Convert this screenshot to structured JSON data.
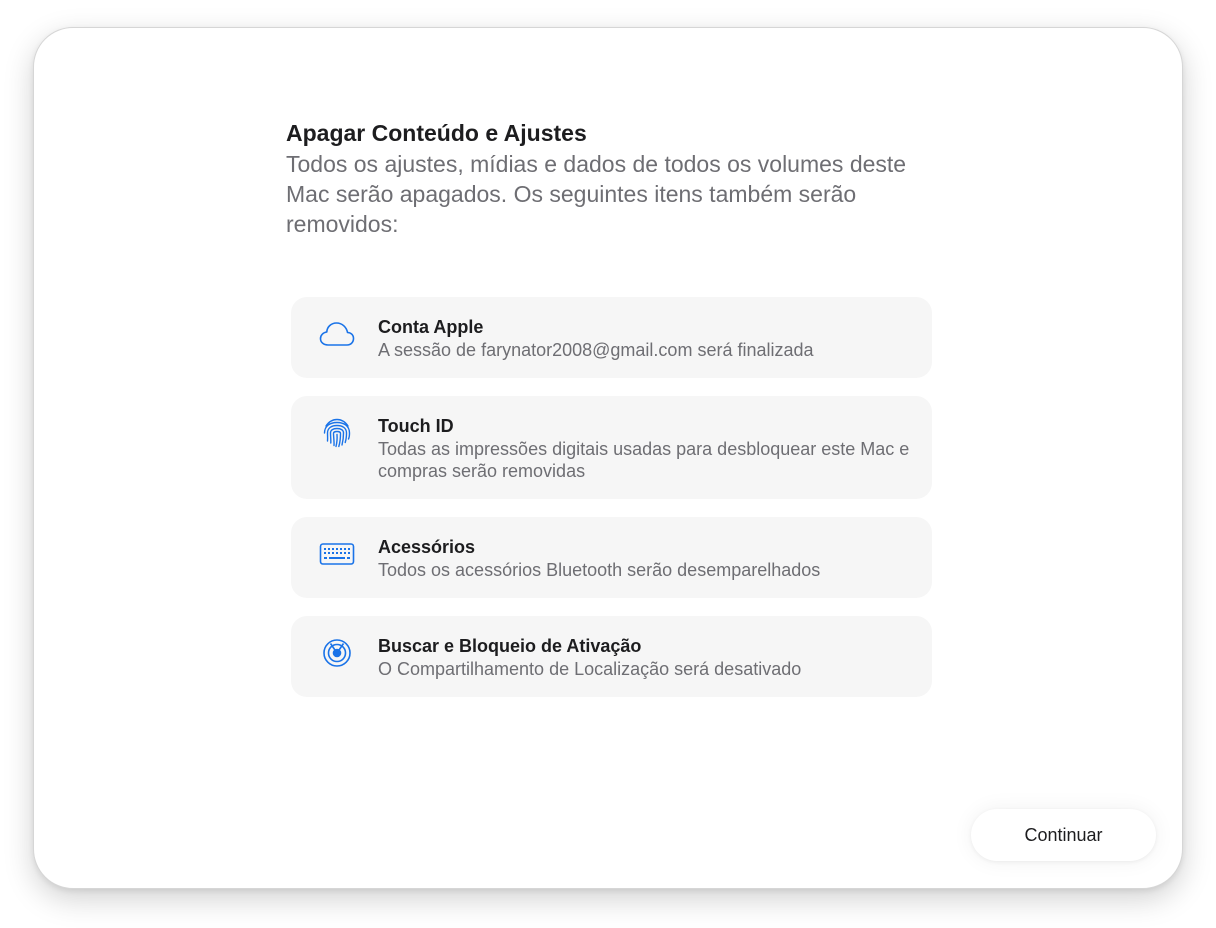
{
  "dialog": {
    "title": "Apagar Conteúdo e Ajustes",
    "description": "Todos os ajustes, mídias e dados de todos os volumes deste Mac serão apagados. Os seguintes itens também serão removidos:"
  },
  "items": [
    {
      "icon": "cloud-icon",
      "title": "Conta Apple",
      "description": "A sessão de farynator2008@gmail.com será finalizada"
    },
    {
      "icon": "fingerprint-icon",
      "title": "Touch ID",
      "description": "Todas as impressões digitais usadas para desbloquear este Mac e compras serão removidas"
    },
    {
      "icon": "keyboard-icon",
      "title": "Acessórios",
      "description": "Todos os acessórios Bluetooth serão desemparelhados"
    },
    {
      "icon": "find-my-icon",
      "title": "Buscar e Bloqueio de Ativação",
      "description": "O Compartilhamento de Localização será desativado"
    }
  ],
  "actions": {
    "continue_label": "Continuar"
  },
  "colors": {
    "accent": "#1a73e8",
    "item_background": "#f6f6f6",
    "secondary_text": "#6e6e73"
  }
}
